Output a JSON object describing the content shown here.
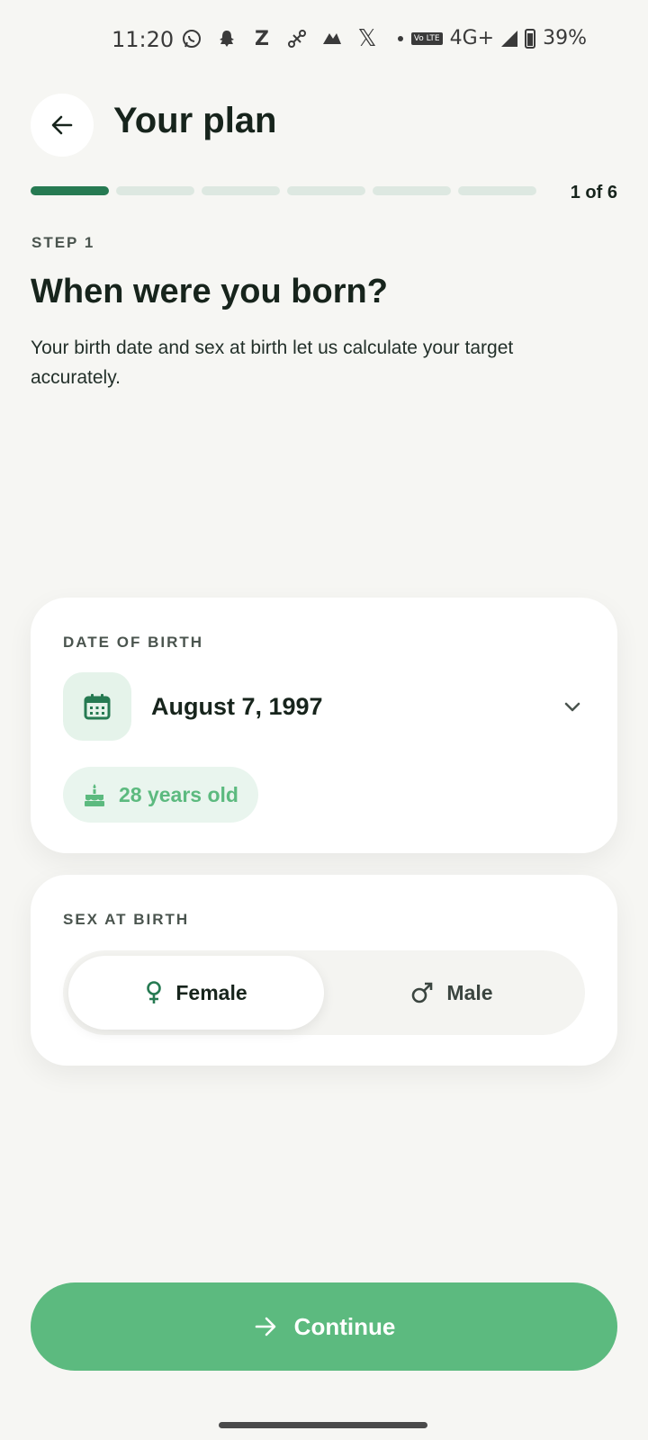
{
  "status_bar": {
    "time": "11:20",
    "network": "4G+",
    "volte": "Vo LTE",
    "battery": "39%",
    "notification_icons": [
      "whatsapp-icon",
      "snapchat-icon",
      "z-icon",
      "scissors-icon",
      "app-icon",
      "x-icon"
    ]
  },
  "header": {
    "title": "Your plan",
    "back_icon": "arrow-left-icon"
  },
  "progress": {
    "current": 1,
    "total": 6,
    "label": "1 of 6"
  },
  "step": {
    "label": "STEP 1",
    "question": "When were you born?",
    "subtitle": "Your birth date and sex at birth let us calculate your target accurately."
  },
  "dob_card": {
    "label": "DATE OF BIRTH",
    "value": "August 7, 1997",
    "icon": "calendar-icon",
    "age_label": "28 years old",
    "age_icon": "cake-icon"
  },
  "sex_card": {
    "label": "SEX AT BIRTH",
    "options": [
      {
        "label": "Female",
        "icon": "female-icon",
        "selected": true
      },
      {
        "label": "Male",
        "icon": "male-icon",
        "selected": false
      }
    ]
  },
  "continue_button": {
    "label": "Continue",
    "icon": "arrow-right-icon"
  },
  "colors": {
    "accent": "#5cba7f",
    "accent_dark": "#267a52",
    "background": "#f6f6f3"
  }
}
